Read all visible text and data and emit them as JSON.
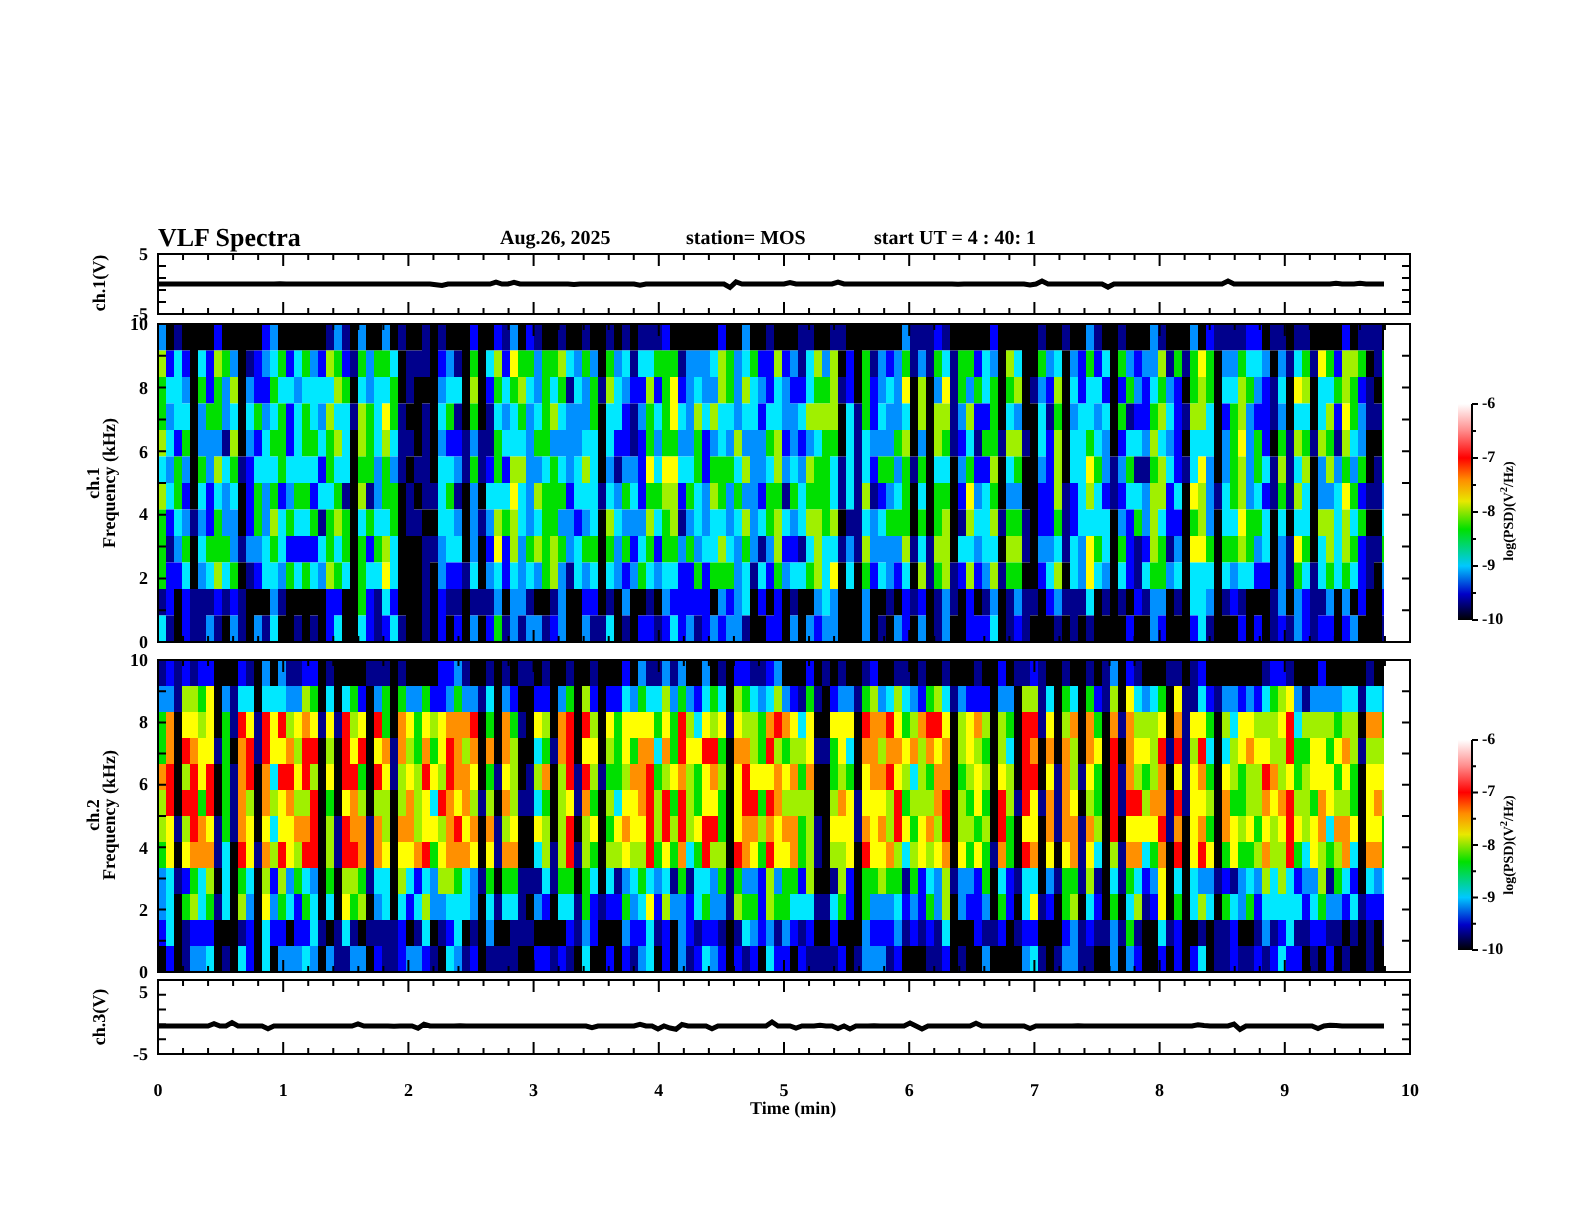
{
  "header": {
    "title": "VLF Spectra",
    "date": "Aug.26, 2025",
    "station": "station= MOS",
    "start": "start  UT =  4 : 40: 1"
  },
  "panels": [
    {
      "kind": "waveform",
      "ylabel": "ch.1(V)",
      "yticks": [
        "5",
        "-5"
      ]
    },
    {
      "kind": "spectrogram",
      "ylabel": "ch.1",
      "ylabel2": "Frequency (kHz)",
      "yticks": [
        "10",
        "8",
        "6",
        "4",
        "2",
        "0"
      ],
      "colorbar": {
        "label": "log(PSD)(V$^{2}$/Hz)",
        "ticks": [
          "-6",
          "-7",
          "-8",
          "-9",
          "-10"
        ]
      }
    },
    {
      "kind": "spectrogram",
      "ylabel": "ch.2",
      "ylabel2": "Frequency (kHz)",
      "yticks": [
        "10",
        "8",
        "6",
        "4",
        "2",
        "0"
      ],
      "colorbar": {
        "label": "log(PSD)(V$^{2}$/Hz)",
        "ticks": [
          "-6",
          "-7",
          "-8",
          "-9",
          "-10"
        ]
      }
    },
    {
      "kind": "waveform",
      "ylabel": "ch.3(V)",
      "yticks": [
        "5",
        "-5"
      ]
    }
  ],
  "xaxis": {
    "label": "Time (min)",
    "ticks": [
      "0",
      "1",
      "2",
      "3",
      "4",
      "5",
      "6",
      "7",
      "8",
      "9",
      "10"
    ]
  }
}
